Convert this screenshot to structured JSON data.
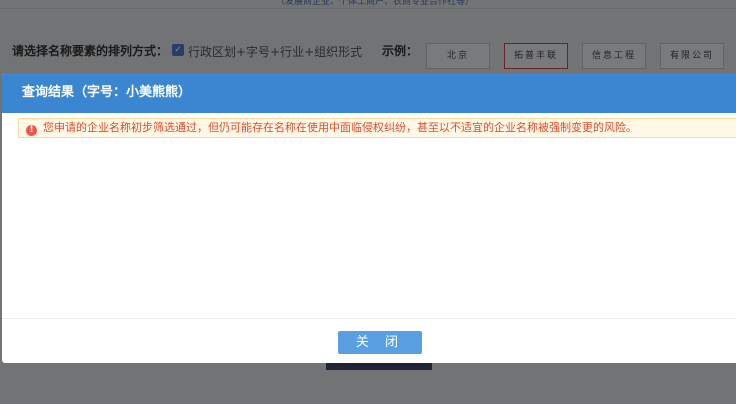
{
  "background": {
    "top_note": "（发展商企业、个体工商户、农商专业合作社等）",
    "order_label": "请选择名称要素的排列方式：",
    "order_option": "行政区划+字号+行业+组织形式",
    "example_label": "示例：",
    "example_tiles": [
      "北京",
      "拓普丰联",
      "信息工程",
      "有限公司"
    ]
  },
  "modal": {
    "title": "查询结果（字号：小美熊熊）",
    "warning_text": "您申请的企业名称初步筛选通过，但仍可能存在名称在使用中面临侵权纠纷，甚至以不适宜的企业名称被强制变更的风险。",
    "close_label": "关 闭"
  },
  "colors": {
    "header": "#3a86d0",
    "warning_text": "#e24a2b",
    "button": "#5b9fe3"
  }
}
